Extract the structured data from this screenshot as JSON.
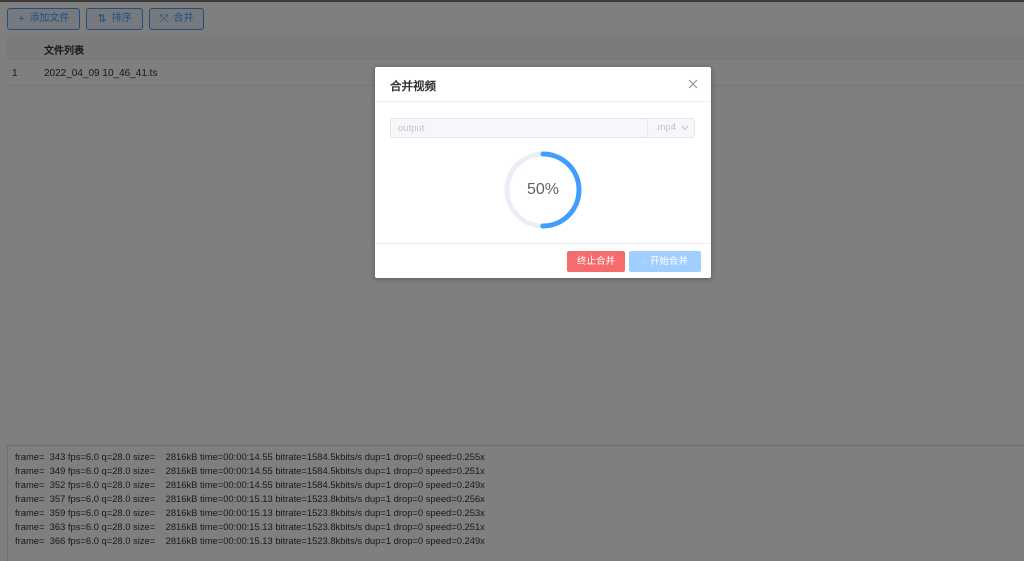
{
  "toolbar": {
    "add_label": "添加文件",
    "sort_label": "排序",
    "merge_label": "合并"
  },
  "table": {
    "header": "文件列表",
    "rows": [
      {
        "index": "1",
        "name": "2022_04_09 10_46_41.ts"
      }
    ]
  },
  "log": {
    "lines": [
      "frame=  343 fps=6.0 q=28.0 size=    2816kB time=00:00:14.55 bitrate=1584.5kbits/s dup=1 drop=0 speed=0.255x",
      "frame=  349 fps=6.0 q=28.0 size=    2816kB time=00:00:14.55 bitrate=1584.5kbits/s dup=1 drop=0 speed=0.251x",
      "frame=  352 fps=6.0 q=28.0 size=    2816kB time=00:00:14.55 bitrate=1584.5kbits/s dup=1 drop=0 speed=0.249x",
      "frame=  357 fps=6.0 q=28.0 size=    2816kB time=00:00:15.13 bitrate=1523.8kbits/s dup=1 drop=0 speed=0.256x",
      "frame=  359 fps=6.0 q=28.0 size=    2816kB time=00:00:15.13 bitrate=1523.8kbits/s dup=1 drop=0 speed=0.253x",
      "frame=  363 fps=6.0 q=28.0 size=    2816kB time=00:00:15.13 bitrate=1523.8kbits/s dup=1 drop=0 speed=0.251x",
      "frame=  366 fps=6.0 q=28.0 size=    2816kB time=00:00:15.13 bitrate=1523.8kbits/s dup=1 drop=0 speed=0.249x"
    ]
  },
  "dialog": {
    "title": "合并视频",
    "output_name": "output",
    "extension": ".mp4",
    "progress_percent": 50,
    "progress_label": "50%",
    "stop_label": "终止合并",
    "start_label": "开始合并",
    "start_icon": "loading-icon",
    "close_icon": "close-icon"
  },
  "colors": {
    "primary": "#409eff",
    "danger": "#f56c6c",
    "primary_light": "#a0cfff",
    "progress_track": "#ebeef5"
  }
}
